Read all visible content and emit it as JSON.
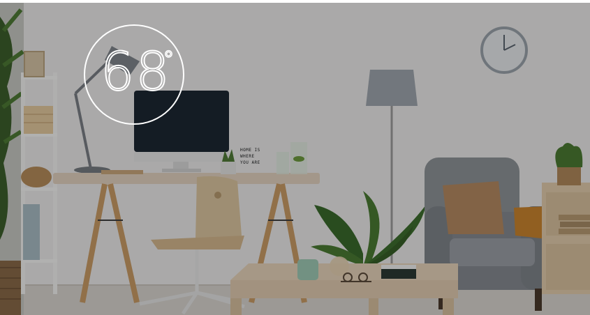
{
  "thermostat": {
    "temperature": "68",
    "degree_symbol": "°"
  },
  "letter_board": {
    "lines": [
      "HOME IS",
      "WHERE",
      "YOU ARE"
    ]
  },
  "colors": {
    "wall": "#ecebea",
    "floor": "#d8d4cf",
    "wood": "#cfa977",
    "chair_fabric": "#8e9398",
    "cushion": "#b58a62",
    "throw_blanket": "#c9842f",
    "plant_green": "#3f6a2a",
    "overlay": "rgba(0,0,0,0.28)",
    "ring": "#ffffff"
  }
}
